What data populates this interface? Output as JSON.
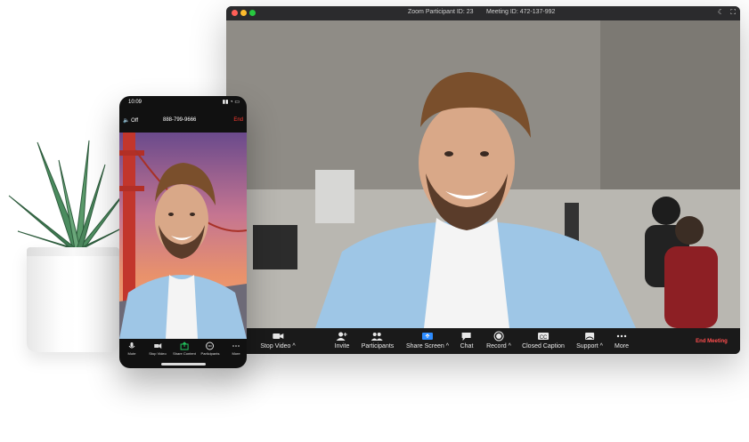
{
  "desktop": {
    "titlebar": {
      "participant_id": "Zoom Participant ID: 23",
      "meeting_id": "Meeting ID: 472-137-992"
    },
    "toolbar": {
      "items": [
        {
          "label": "Stop Video ^",
          "icon": "video-camera-icon"
        },
        {
          "label": "Invite",
          "icon": "add-person-icon"
        },
        {
          "label": "Participants",
          "icon": "participants-icon"
        },
        {
          "label": "Share Screen ^",
          "icon": "share-screen-icon"
        },
        {
          "label": "Chat",
          "icon": "chat-bubble-icon"
        },
        {
          "label": "Record ^",
          "icon": "record-icon"
        },
        {
          "label": "Closed Caption",
          "icon": "closed-caption-icon"
        },
        {
          "label": "Support ^",
          "icon": "support-icon"
        },
        {
          "label": "More",
          "icon": "more-dots-icon"
        }
      ],
      "end_meeting": "End Meeting"
    }
  },
  "phone": {
    "status_time": "10:09",
    "speaker": "Off",
    "phone_number": "888-799-9666",
    "end": "End",
    "toolbar": [
      {
        "label": "Mute",
        "icon": "microphone-icon"
      },
      {
        "label": "Stop Video",
        "icon": "video-camera-icon"
      },
      {
        "label": "Share Content",
        "icon": "share-icon"
      },
      {
        "label": "Participants",
        "icon": "participants-icon"
      },
      {
        "label": "More",
        "icon": "more-dots-icon"
      }
    ]
  },
  "colors": {
    "end_red": "#ff4d4d",
    "share_blue": "#2d8cff",
    "share_green": "#22c55e",
    "toolbar_bg": "#1a1a1a"
  }
}
